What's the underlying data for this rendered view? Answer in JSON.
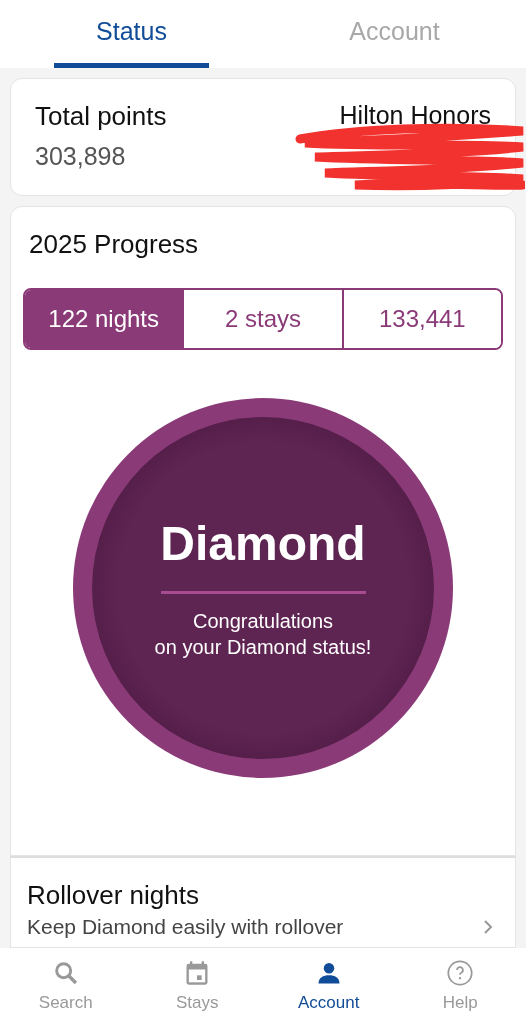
{
  "tabs": [
    {
      "label": "Status",
      "selected": true
    },
    {
      "label": "Account",
      "selected": false
    }
  ],
  "points_card": {
    "title": "Total points",
    "value": "303,898",
    "program": "Hilton Honors"
  },
  "progress": {
    "title": "2025 Progress",
    "segments": [
      {
        "label": "122 nights",
        "selected": true
      },
      {
        "label": "2 stays",
        "selected": false
      },
      {
        "label": "133,441",
        "selected": false
      }
    ],
    "tier": "Diamond",
    "message_lines": [
      "Congratulations",
      "on your Diamond status!"
    ]
  },
  "rollover": {
    "title": "Rollover nights",
    "subtitle": "Keep Diamond easily with rollover"
  },
  "nav": [
    {
      "label": "Search",
      "kind": "search",
      "selected": false
    },
    {
      "label": "Stays",
      "kind": "stays",
      "selected": false
    },
    {
      "label": "Account",
      "kind": "account",
      "selected": true
    },
    {
      "label": "Help",
      "kind": "help",
      "selected": false
    }
  ]
}
